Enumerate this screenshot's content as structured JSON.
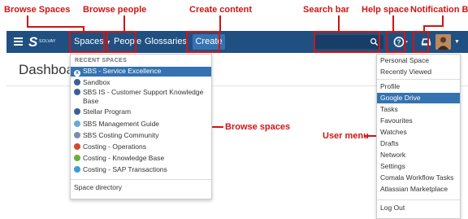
{
  "annotations": {
    "browse_spaces": "Browse Spaces",
    "browse_people": "Browse people",
    "create_content": "Create content",
    "search_bar": "Search bar",
    "help_space": "Help space",
    "notification_box": "Notification Box",
    "browse_spaces_side": "Browse spaces",
    "user_menu": "User menu"
  },
  "colors": {
    "navbar": "#205081",
    "create_button": "#3572b0",
    "selected_item": "#3572b0",
    "annotation_red": "#d01515"
  },
  "header": {
    "menu_icon": "hamburger-icon",
    "logo_mark": "S",
    "logo_text": "SOLVAY",
    "spaces_label": "Spaces",
    "people_label": "People",
    "glossaries_label": "Glossaries",
    "create_label": "Create",
    "search_placeholder": "",
    "search_icon": "search-icon",
    "help_icon": "question-circle-icon",
    "notification_icon": "notification-icon",
    "avatar_icon": "user-avatar"
  },
  "page": {
    "title": "Dashboard"
  },
  "spaces_menu": {
    "heading": "RECENT SPACES",
    "items": [
      {
        "label": "SBS - Service Excellence",
        "icon": "space-x-icon",
        "color": "#3a5f96",
        "selected": true
      },
      {
        "label": "Sandbox",
        "icon": "space-x-icon",
        "color": "#3a5f96"
      },
      {
        "label": "SBS IS - Customer Support Knowledge",
        "label2": "Base",
        "icon": "space-x-icon",
        "color": "#3a5f96"
      },
      {
        "label": "Stellar Program",
        "icon": "space-x-icon",
        "color": "#3a5f96"
      },
      {
        "label": "SBS Management Guide",
        "icon": "space-globe-icon",
        "color": "#6aa8d8"
      },
      {
        "label": "SBS Costing Community",
        "icon": "space-people-icon",
        "color": "#7a8db0"
      },
      {
        "label": "Costing - Operations",
        "icon": "space-gear-icon",
        "color": "#d04a2f"
      },
      {
        "label": "Costing - Knowledge Base",
        "icon": "space-leaf-icon",
        "color": "#6cae3a"
      },
      {
        "label": "Costing - SAP Transactions",
        "icon": "space-cube-icon",
        "color": "#3b9ed6"
      }
    ],
    "footer": "Space directory"
  },
  "user_menu": {
    "items": [
      {
        "label": "Personal Space"
      },
      {
        "label": "Recently Viewed"
      },
      {
        "label": "Profile"
      },
      {
        "label": "Google Drive",
        "selected": true
      },
      {
        "label": "Tasks"
      },
      {
        "label": "Favourites"
      },
      {
        "label": "Watches"
      },
      {
        "label": "Drafts"
      },
      {
        "label": "Network"
      },
      {
        "label": "Settings"
      },
      {
        "label": "Comala Workflow Tasks"
      },
      {
        "label": "Atlassian Marketplace"
      },
      {
        "label": "Log Out"
      }
    ]
  }
}
